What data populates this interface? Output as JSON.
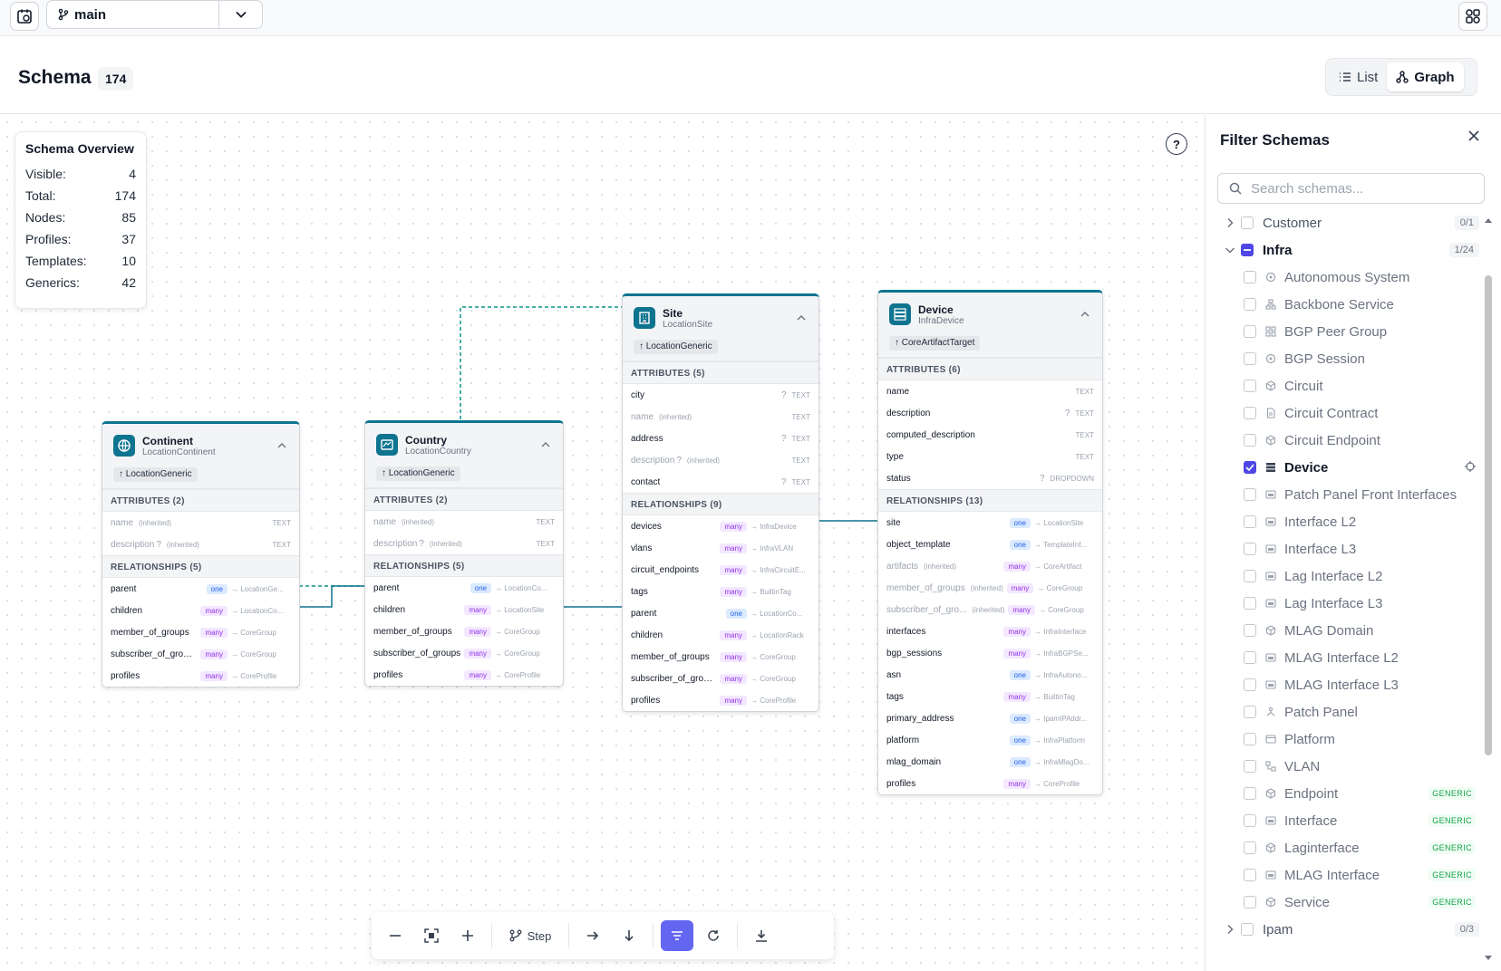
{
  "topbar": {
    "branch": "main"
  },
  "header": {
    "title": "Schema",
    "count": "174",
    "view_list": "List",
    "view_graph": "Graph"
  },
  "overview": {
    "title": "Schema Overview",
    "rows": [
      {
        "label": "Visible:",
        "value": "4"
      },
      {
        "label": "Total:",
        "value": "174"
      },
      {
        "label": "Nodes:",
        "value": "85"
      },
      {
        "label": "Profiles:",
        "value": "37"
      },
      {
        "label": "Templates:",
        "value": "10"
      },
      {
        "label": "Generics:",
        "value": "42"
      }
    ]
  },
  "nodes": {
    "continent": {
      "title": "Continent",
      "sub": "LocationContinent",
      "inherit": "↑ LocationGeneric",
      "attr_header": "ATTRIBUTES (2)",
      "attrs": [
        {
          "name": "name",
          "note": "(inherited)",
          "type": "TEXT"
        },
        {
          "name": "description",
          "opt": "?",
          "note": "(inherited)",
          "type": "TEXT"
        }
      ],
      "rel_header": "RELATIONSHIPS (5)",
      "rels": [
        {
          "name": "parent",
          "card": "one",
          "peer": "→ LocationGe..."
        },
        {
          "name": "children",
          "card": "many",
          "peer": "→ LocationCo..."
        },
        {
          "name": "member_of_groups",
          "card": "many",
          "peer": "→ CoreGroup"
        },
        {
          "name": "subscriber_of_groups",
          "card": "many",
          "peer": "→ CoreGroup"
        },
        {
          "name": "profiles",
          "card": "many",
          "peer": "→ CoreProfile"
        }
      ]
    },
    "country": {
      "title": "Country",
      "sub": "LocationCountry",
      "inherit": "↑ LocationGeneric",
      "attr_header": "ATTRIBUTES (2)",
      "attrs": [
        {
          "name": "name",
          "note": "(inherited)",
          "type": "TEXT"
        },
        {
          "name": "description",
          "opt": "?",
          "note": "(inherited)",
          "type": "TEXT"
        }
      ],
      "rel_header": "RELATIONSHIPS (5)",
      "rels": [
        {
          "name": "parent",
          "card": "one",
          "peer": "→ LocationCo..."
        },
        {
          "name": "children",
          "card": "many",
          "peer": "→ LocationSite"
        },
        {
          "name": "member_of_groups",
          "card": "many",
          "peer": "→ CoreGroup"
        },
        {
          "name": "subscriber_of_groups",
          "card": "many",
          "peer": "→ CoreGroup"
        },
        {
          "name": "profiles",
          "card": "many",
          "peer": "→ CoreProfile"
        }
      ]
    },
    "site": {
      "title": "Site",
      "sub": "LocationSite",
      "inherit": "↑ LocationGeneric",
      "attr_header": "ATTRIBUTES (5)",
      "attrs": [
        {
          "name": "city",
          "opt": "?",
          "type": "TEXT"
        },
        {
          "name": "name",
          "note": "(inherited)",
          "type": "TEXT"
        },
        {
          "name": "address",
          "opt": "?",
          "type": "TEXT"
        },
        {
          "name": "description",
          "opt": "?",
          "note": "(inherited)",
          "type": "TEXT"
        },
        {
          "name": "contact",
          "opt": "?",
          "type": "TEXT"
        }
      ],
      "rel_header": "RELATIONSHIPS (9)",
      "rels": [
        {
          "name": "devices",
          "card": "many",
          "peer": "→ InfraDevice"
        },
        {
          "name": "vlans",
          "card": "many",
          "peer": "→ InfraVLAN"
        },
        {
          "name": "circuit_endpoints",
          "card": "many",
          "peer": "→ InfraCircuitE..."
        },
        {
          "name": "tags",
          "card": "many",
          "peer": "→ BuiltinTag"
        },
        {
          "name": "parent",
          "card": "one",
          "peer": "→ LocationCo..."
        },
        {
          "name": "children",
          "card": "many",
          "peer": "→ LocationRack"
        },
        {
          "name": "member_of_groups",
          "card": "many",
          "peer": "→ CoreGroup"
        },
        {
          "name": "subscriber_of_groups",
          "card": "many",
          "peer": "→ CoreGroup"
        },
        {
          "name": "profiles",
          "card": "many",
          "peer": "→ CoreProfile"
        }
      ]
    },
    "device": {
      "title": "Device",
      "sub": "InfraDevice",
      "inherit": "↑ CoreArtifactTarget",
      "attr_header": "ATTRIBUTES (6)",
      "attrs": [
        {
          "name": "name",
          "type": "TEXT"
        },
        {
          "name": "description",
          "opt": "?",
          "type": "TEXT"
        },
        {
          "name": "computed_description",
          "type": "TEXT"
        },
        {
          "name": "type",
          "type": "TEXT"
        },
        {
          "name": "status",
          "opt": "?",
          "type": "DROPDOWN"
        }
      ],
      "rel_header": "RELATIONSHIPS (13)",
      "rels": [
        {
          "name": "site",
          "card": "one",
          "peer": "→ LocationSite"
        },
        {
          "name": "object_template",
          "card": "one",
          "peer": "→ TemplateInf..."
        },
        {
          "name": "artifacts",
          "note": "(inherited)",
          "card": "many",
          "peer": "→ CoreArtifact"
        },
        {
          "name": "member_of_groups",
          "note": "(inherited)",
          "card": "many",
          "peer": "→ CoreGroup"
        },
        {
          "name": "subscriber_of_gro...",
          "note": "(inherited)",
          "card": "many",
          "peer": "→ CoreGroup"
        },
        {
          "name": "interfaces",
          "card": "many",
          "peer": "→ InfraInterface"
        },
        {
          "name": "bgp_sessions",
          "card": "many",
          "peer": "→ InfraBGPSe..."
        },
        {
          "name": "asn",
          "card": "one",
          "peer": "→ InfraAutono..."
        },
        {
          "name": "tags",
          "card": "many",
          "peer": "→ BuiltinTag"
        },
        {
          "name": "primary_address",
          "card": "one",
          "peer": "→ IpamIPAddr..."
        },
        {
          "name": "platform",
          "card": "one",
          "peer": "→ InfraPlatform"
        },
        {
          "name": "mlag_domain",
          "card": "one",
          "peer": "→ InfraMlagDo..."
        },
        {
          "name": "profiles",
          "card": "many",
          "peer": "→ CoreProfile"
        }
      ]
    }
  },
  "toolbar": {
    "step_label": "Step"
  },
  "filter": {
    "title": "Filter Schemas",
    "search_placeholder": "Search schemas...",
    "groups_top": [
      {
        "name": "Customer",
        "count": "0/1"
      }
    ],
    "infra": {
      "name": "Infra",
      "count": "1/24"
    },
    "infra_items": [
      {
        "name": "Autonomous System",
        "icon": "circle-icon"
      },
      {
        "name": "Backbone Service",
        "icon": "network-icon"
      },
      {
        "name": "BGP Peer Group",
        "icon": "grid-icon"
      },
      {
        "name": "BGP Session",
        "icon": "circle-icon"
      },
      {
        "name": "Circuit",
        "icon": "cube-icon"
      },
      {
        "name": "Circuit Contract",
        "icon": "file-icon"
      },
      {
        "name": "Circuit Endpoint",
        "icon": "cube-icon"
      },
      {
        "name": "Device",
        "icon": "server-icon",
        "checked": true
      },
      {
        "name": "Patch Panel Front Interfaces",
        "icon": "port-icon"
      },
      {
        "name": "Interface L2",
        "icon": "port-icon"
      },
      {
        "name": "Interface L3",
        "icon": "port-icon"
      },
      {
        "name": "Lag Interface L2",
        "icon": "port-icon"
      },
      {
        "name": "Lag Interface L3",
        "icon": "port-icon"
      },
      {
        "name": "MLAG Domain",
        "icon": "cube-icon"
      },
      {
        "name": "MLAG Interface L2",
        "icon": "port-icon"
      },
      {
        "name": "MLAG Interface L3",
        "icon": "port-icon"
      },
      {
        "name": "Patch Panel",
        "icon": "branch-icon"
      },
      {
        "name": "Platform",
        "icon": "window-icon"
      },
      {
        "name": "VLAN",
        "icon": "vlan-icon"
      },
      {
        "name": "Endpoint",
        "icon": "cube-icon",
        "tag": "GENERIC"
      },
      {
        "name": "Interface",
        "icon": "port-icon",
        "tag": "GENERIC"
      },
      {
        "name": "Laginterface",
        "icon": "cube-icon",
        "tag": "GENERIC"
      },
      {
        "name": "MLAG Interface",
        "icon": "port-icon",
        "tag": "GENERIC"
      },
      {
        "name": "Service",
        "icon": "cube-icon",
        "tag": "GENERIC"
      }
    ],
    "groups_bottom": [
      {
        "name": "Ipam",
        "count": "0/3"
      }
    ]
  }
}
